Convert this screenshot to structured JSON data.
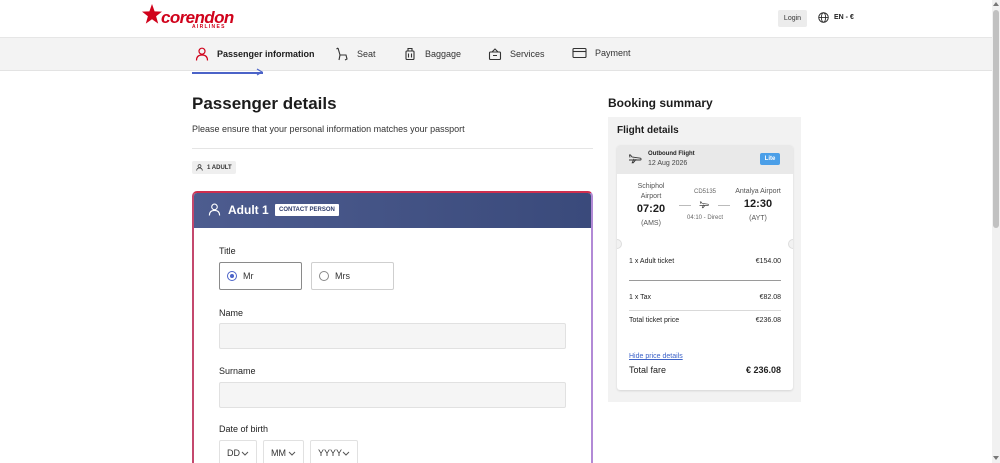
{
  "header": {
    "logo_text": "corendon",
    "logo_sub": "AIRLINES",
    "login_label": "Login",
    "lang_label": "EN - €"
  },
  "steps": [
    {
      "label": "Passenger information",
      "icon": "person-icon",
      "active": true
    },
    {
      "label": "Seat",
      "icon": "seat-icon",
      "active": false
    },
    {
      "label": "Baggage",
      "icon": "baggage-icon",
      "active": false
    },
    {
      "label": "Services",
      "icon": "services-icon",
      "active": false
    },
    {
      "label": "Payment",
      "icon": "payment-icon",
      "active": false
    }
  ],
  "main": {
    "title": "Passenger details",
    "subtitle": "Please ensure that your personal information matches your passport",
    "adult_chip": "1 ADULT"
  },
  "passenger_card": {
    "title": "Adult 1",
    "contact_tag": "CONTACT PERSON",
    "title_label": "Title",
    "title_options": [
      {
        "label": "Mr",
        "selected": true
      },
      {
        "label": "Mrs",
        "selected": false
      }
    ],
    "name_label": "Name",
    "name_value": "",
    "surname_label": "Surname",
    "surname_value": "",
    "dob_label": "Date of birth",
    "dob_day": "DD",
    "dob_month": "MM",
    "dob_year": "YYYY"
  },
  "summary": {
    "title": "Booking summary",
    "flight_details_title": "Flight details",
    "outbound_label": "Outbound Flight",
    "date": "12 Aug 2026",
    "fare_badge": "Lite",
    "origin_name_1": "Schiphol",
    "origin_name_2": "Airport",
    "origin_time": "07:20",
    "origin_code": "(AMS)",
    "flight_no": "CD5135",
    "duration": "04:10 - Direct",
    "dest_name": "Antalya Airport",
    "dest_time": "12:30",
    "dest_code": "(AYT)",
    "lines": [
      {
        "label": "1 x Adult ticket",
        "value": "€154.00"
      },
      {
        "label": "1 x Tax",
        "value": "€82.08"
      },
      {
        "label": "Total ticket price",
        "value": "€236.08"
      }
    ],
    "hide_link": "Hide price details",
    "total_label": "Total fare",
    "total_value": "€ 236.08"
  },
  "colors": {
    "brand_red": "#d0021b",
    "accent_blue": "#4b63c8",
    "card_header": "#3e4d7f",
    "badge_blue": "#4b9fe8"
  }
}
